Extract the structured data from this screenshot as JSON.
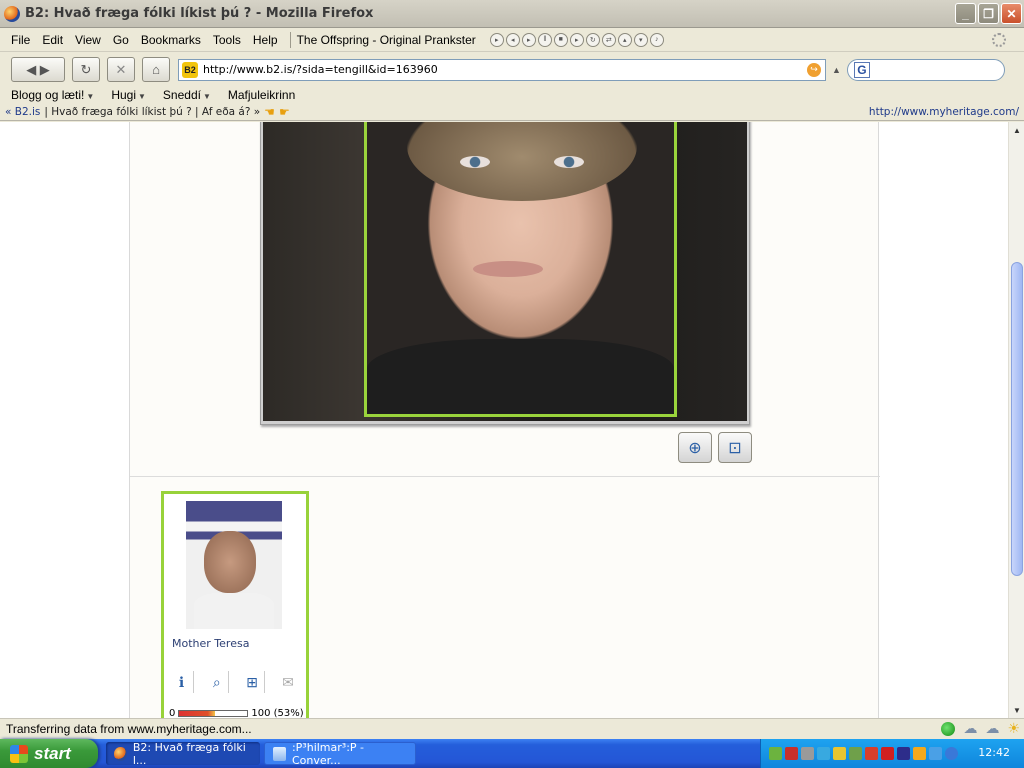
{
  "window": {
    "title": "B2: Hvað fræga fólki líkist þú ? - Mozilla Firefox",
    "minimize": "_",
    "maximize": "❐",
    "close": "✕"
  },
  "menu": {
    "items": [
      "File",
      "Edit",
      "View",
      "Go",
      "Bookmarks",
      "Tools",
      "Help"
    ],
    "now_playing": "The Offspring - Original Prankster"
  },
  "nav": {
    "url": "http://www.b2.is/?sida=tengill&id=163960",
    "site_icon": "B2",
    "search_icon_letter": "G",
    "search_placeholder": ""
  },
  "bookmarks": [
    "Blogg og læti!",
    "Hugi",
    "Sneddí",
    "Mafjuleikrinn"
  ],
  "b2toolbar": {
    "crumb": "« B2.is",
    "crumb_rest": "| Hvað fræga fólki líkist þú ? | Af eða á? »",
    "right_link": "http://www.myheritage.com/"
  },
  "match": {
    "name": "Mother Teresa",
    "score_min": "0",
    "score_label": "100 (53%)",
    "score_fraction": 0.53
  },
  "status": {
    "text": "Transferring data from www.myheritage.com..."
  },
  "taskbar": {
    "start": "start",
    "tasks": [
      {
        "label": "B2: Hvað fræga fólki l..."
      },
      {
        "label": ":P³hilmar³:P - Conver..."
      }
    ],
    "clock": "12:42"
  },
  "colors": {
    "face_box": "#9ad43c",
    "match_border": "#98d23a",
    "link": "#1f3a8a"
  }
}
